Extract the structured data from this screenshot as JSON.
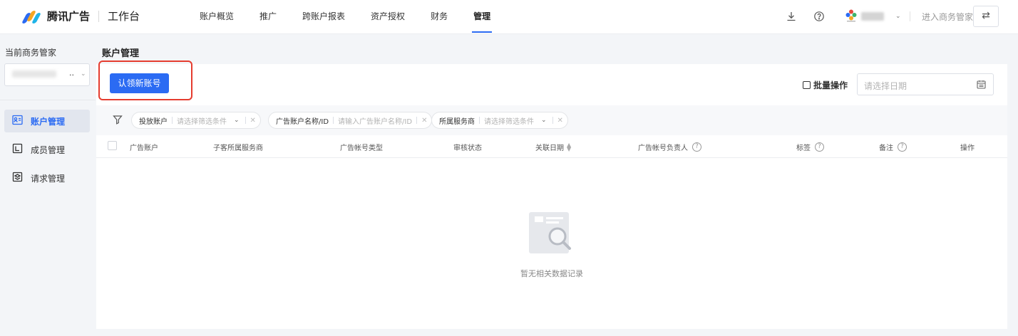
{
  "brand": {
    "name": "腾讯广告",
    "subtitle": "工作台"
  },
  "nav": {
    "items": [
      {
        "label": "账户概览",
        "active": false
      },
      {
        "label": "推广",
        "active": false
      },
      {
        "label": "跨账户报表",
        "active": false
      },
      {
        "label": "资产授权",
        "active": false
      },
      {
        "label": "财务",
        "active": false
      },
      {
        "label": "管理",
        "active": true
      }
    ],
    "enter_label": "进入商务管家"
  },
  "sidebar": {
    "title": "当前商务管家",
    "select_ellipsis": "..",
    "items": [
      {
        "label": "账户管理",
        "icon": "id-card-icon",
        "active": true
      },
      {
        "label": "成员管理",
        "icon": "member-square-icon",
        "active": false
      },
      {
        "label": "请求管理",
        "icon": "request-stack-icon",
        "active": false
      }
    ]
  },
  "main": {
    "page_title": "账户管理",
    "claim_button": "认领新账号",
    "batch_label": "批量操作",
    "date_placeholder": "请选择日期",
    "filters": [
      {
        "key": "投放账户",
        "placeholder": "请选择筛选条件",
        "dropdown": true
      },
      {
        "key": "广告账户名称/ID",
        "placeholder": "请输入广告账户名称/ID",
        "dropdown": false
      },
      {
        "key": "所属服务商",
        "placeholder": "请选择筛选条件",
        "dropdown": true
      }
    ],
    "columns": [
      "广告账户",
      "子客所属服务商",
      "广告帐号类型",
      "审核状态",
      "关联日期",
      "广告帐号负责人",
      "标签",
      "备注",
      "操作"
    ],
    "empty_text": "暂无相关数据记录"
  },
  "colors": {
    "accent": "#2b6bf3",
    "highlight": "#e53c2f"
  }
}
